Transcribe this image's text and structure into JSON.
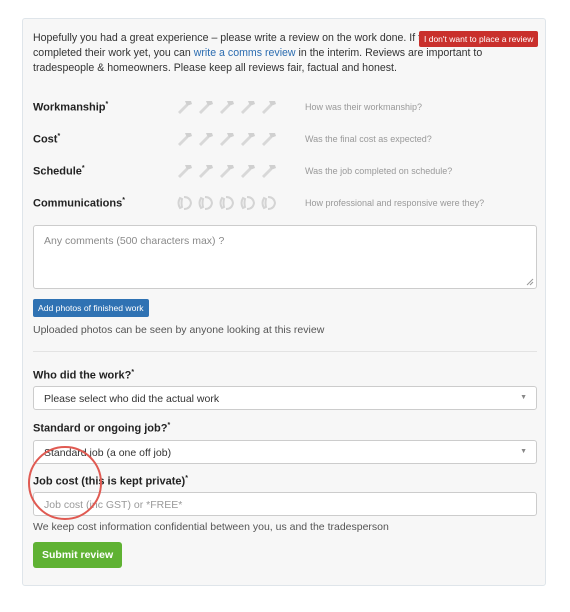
{
  "intro": {
    "text_before_link": "Hopefully you had a great experience – please write a review on the work done. If this tradesperson has not completed their work yet, you can ",
    "link_text": "write a comms review",
    "text_after_link": " in the interim. Reviews are important to tradespeople & homeowners. Please keep all reviews fair, factual and honest."
  },
  "decline_button": "I don't want to place a review",
  "ratings": [
    {
      "label": "Workmanship",
      "hint": "How was their workmanship?",
      "icon": "hammer-icon"
    },
    {
      "label": "Cost",
      "hint": "Was the final cost as expected?",
      "icon": "hammer-icon"
    },
    {
      "label": "Schedule",
      "hint": "Was the job completed on schedule?",
      "icon": "hammer-icon"
    },
    {
      "label": "Communications",
      "hint": "How professional and responsive were they?",
      "icon": "phone-icon"
    }
  ],
  "comments": {
    "placeholder": "Any comments (500 characters max) ?"
  },
  "photos": {
    "button": "Add photos of finished work",
    "note": "Uploaded photos can be seen by anyone looking at this review"
  },
  "who": {
    "question": "Who did the work?",
    "value": "Please select who did the actual work"
  },
  "job_type": {
    "question": "Standard or ongoing job?",
    "value": "Standard job (a one off job)"
  },
  "job_cost": {
    "question": "Job cost (this is kept private)",
    "placeholder": "Job cost (inc GST) or *FREE*",
    "note": "We keep cost information confidential between you, us and the tradesperson"
  },
  "submit_button": "Submit review",
  "required_marker": "*",
  "colors": {
    "decline": "#c9302c",
    "photo_button": "#2f72b3",
    "submit": "#5fb233",
    "annotation_circle": "#e05a52"
  }
}
